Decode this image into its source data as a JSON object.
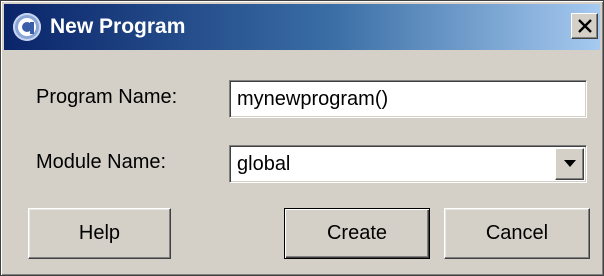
{
  "window": {
    "title": "New Program",
    "app_icon": "app-logo-icon",
    "close_icon": "close-icon"
  },
  "form": {
    "program_name_label": "Program Name:",
    "program_name_value": "mynewprogram()",
    "module_name_label": "Module Name:",
    "module_name_value": "global",
    "dropdown_icon": "chevron-down-icon"
  },
  "buttons": {
    "help": "Help",
    "create": "Create",
    "cancel": "Cancel"
  },
  "colors": {
    "titlebar_start": "#0a246a",
    "titlebar_end": "#a6caf0",
    "dialog_bg": "#d4d0c8"
  }
}
